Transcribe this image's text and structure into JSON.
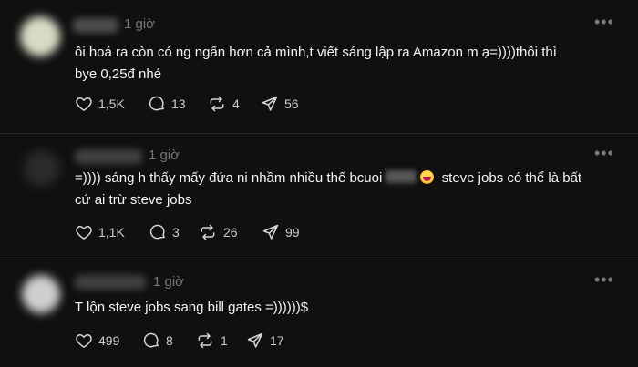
{
  "posts": [
    {
      "time": "1 giờ",
      "line1": "ôi hoá ra còn có ng ngẩn hơn cả mình,t viết sáng lập ra Amazon m ạ=))))thôi thì",
      "line2": "bye 0,25đ nhé",
      "likes": "1,5K",
      "comments": "13",
      "reposts": "4",
      "shares": "56"
    },
    {
      "time": "1 giờ",
      "line1_a": "=)))) sáng h thấy mấy đứa ni nhầm nhiều thế bcuoi",
      "line1_b": "steve jobs có thể là bất",
      "line2": "cứ ai trừ steve jobs",
      "likes": "1,1K",
      "comments": "3",
      "reposts": "26",
      "shares": "99"
    },
    {
      "time": "1 giờ",
      "line1": "T lộn steve jobs sang bill gates =))))))$",
      "likes": "499",
      "comments": "8",
      "reposts": "1",
      "shares": "17"
    }
  ],
  "icons": {
    "like": "heart-icon",
    "comment": "comment-icon",
    "repost": "repost-icon",
    "share": "share-icon",
    "more": "more-icon"
  }
}
